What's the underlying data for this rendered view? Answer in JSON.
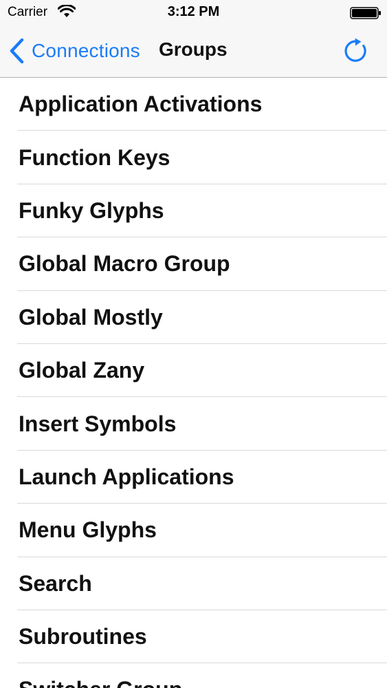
{
  "status_bar": {
    "carrier": "Carrier",
    "time": "3:12 PM",
    "icons": [
      "wifi-icon",
      "battery-icon"
    ]
  },
  "nav": {
    "back_label": "Connections",
    "title": "Groups",
    "back_icon": "chevron-left-icon",
    "refresh_icon": "refresh-icon"
  },
  "groups": [
    "Application Activations",
    "Function Keys",
    "Funky Glyphs",
    "Global Macro Group",
    "Global Mostly",
    "Global Zany",
    "Insert Symbols",
    "Launch Applications",
    "Menu Glyphs",
    "Search",
    "Subroutines",
    "Switcher Group"
  ],
  "colors": {
    "accent": "#1a7cf9",
    "nav_background": "#f7f7f8",
    "separator": "#d9d9dc",
    "text": "#111111"
  }
}
